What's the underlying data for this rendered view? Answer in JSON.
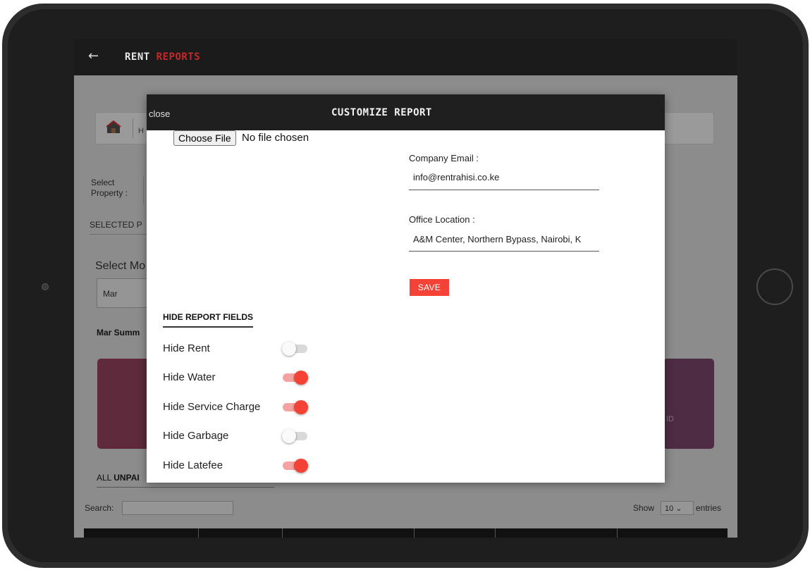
{
  "app": {
    "title_part1": "RENT",
    "title_part2": "REPORTS",
    "back_glyph": "←"
  },
  "background": {
    "property_letter": "H",
    "select_property_line1": "Select",
    "select_property_line2": "Property :",
    "selected_prefix": "SELECTED P",
    "select_month_label": "Select Mo",
    "month_value": "Mar",
    "summary_label": "Mar Summ",
    "card_right_text": "ID",
    "unpaid_prefix": "ALL ",
    "unpaid_bold": "UNPAI",
    "search_label": "Search:",
    "show_label": "Show",
    "entries_value": "10",
    "entries_label": "entries"
  },
  "modal": {
    "close_label": "close",
    "title": "CUSTOMIZE REPORT",
    "file_button_label": "Choose File",
    "file_status": "No file chosen",
    "company_email_label": "Company Email :",
    "company_email_value": "info@rentrahisi.co.ke",
    "office_location_label": "Office Location :",
    "office_location_value": "A&M Center, Northern Bypass, Nairobi, K",
    "save_label": "SAVE",
    "hide_fields_heading": "HIDE REPORT FIELDS",
    "toggles": [
      {
        "label": "Hide Rent",
        "on": false
      },
      {
        "label": "Hide Water",
        "on": true
      },
      {
        "label": "Hide Service Charge",
        "on": true
      },
      {
        "label": "Hide Garbage",
        "on": false
      },
      {
        "label": "Hide Latefee",
        "on": true
      }
    ]
  },
  "colors": {
    "accent_red": "#f44336",
    "header_dark": "#1f1f1f",
    "title_accent": "#c62828"
  }
}
